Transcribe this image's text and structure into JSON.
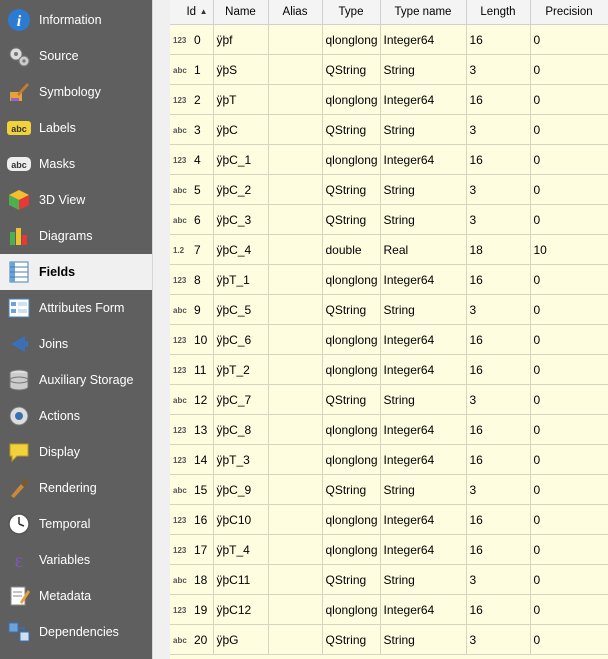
{
  "sidebar": {
    "items": [
      {
        "label": "Information",
        "icon": "information-icon"
      },
      {
        "label": "Source",
        "icon": "source-icon"
      },
      {
        "label": "Symbology",
        "icon": "symbology-icon"
      },
      {
        "label": "Labels",
        "icon": "labels-icon"
      },
      {
        "label": "Masks",
        "icon": "masks-icon"
      },
      {
        "label": "3D View",
        "icon": "3d-view-icon"
      },
      {
        "label": "Diagrams",
        "icon": "diagrams-icon"
      },
      {
        "label": "Fields",
        "icon": "fields-icon",
        "active": true
      },
      {
        "label": "Attributes Form",
        "icon": "attributes-form-icon"
      },
      {
        "label": "Joins",
        "icon": "joins-icon"
      },
      {
        "label": "Auxiliary Storage",
        "icon": "auxiliary-storage-icon"
      },
      {
        "label": "Actions",
        "icon": "actions-icon"
      },
      {
        "label": "Display",
        "icon": "display-icon"
      },
      {
        "label": "Rendering",
        "icon": "rendering-icon"
      },
      {
        "label": "Temporal",
        "icon": "temporal-icon"
      },
      {
        "label": "Variables",
        "icon": "variables-icon"
      },
      {
        "label": "Metadata",
        "icon": "metadata-icon"
      },
      {
        "label": "Dependencies",
        "icon": "dependencies-icon"
      }
    ]
  },
  "table": {
    "headers": [
      "Id",
      "Name",
      "Alias",
      "Type",
      "Type name",
      "Length",
      "Precision"
    ],
    "rows": [
      {
        "tag": "123",
        "id": "0",
        "name": "ÿþf",
        "alias": "",
        "type": "qlonglong",
        "type_name": "Integer64",
        "length": "16",
        "precision": "0"
      },
      {
        "tag": "abc",
        "id": "1",
        "name": "ÿþS",
        "alias": "",
        "type": "QString",
        "type_name": "String",
        "length": "3",
        "precision": "0"
      },
      {
        "tag": "123",
        "id": "2",
        "name": "ÿþT",
        "alias": "",
        "type": "qlonglong",
        "type_name": "Integer64",
        "length": "16",
        "precision": "0"
      },
      {
        "tag": "abc",
        "id": "3",
        "name": "ÿþC",
        "alias": "",
        "type": "QString",
        "type_name": "String",
        "length": "3",
        "precision": "0"
      },
      {
        "tag": "123",
        "id": "4",
        "name": "ÿþC_1",
        "alias": "",
        "type": "qlonglong",
        "type_name": "Integer64",
        "length": "16",
        "precision": "0"
      },
      {
        "tag": "abc",
        "id": "5",
        "name": "ÿþC_2",
        "alias": "",
        "type": "QString",
        "type_name": "String",
        "length": "3",
        "precision": "0"
      },
      {
        "tag": "abc",
        "id": "6",
        "name": "ÿþC_3",
        "alias": "",
        "type": "QString",
        "type_name": "String",
        "length": "3",
        "precision": "0"
      },
      {
        "tag": "1.2",
        "id": "7",
        "name": "ÿþC_4",
        "alias": "",
        "type": "double",
        "type_name": "Real",
        "length": "18",
        "precision": "10"
      },
      {
        "tag": "123",
        "id": "8",
        "name": "ÿþT_1",
        "alias": "",
        "type": "qlonglong",
        "type_name": "Integer64",
        "length": "16",
        "precision": "0"
      },
      {
        "tag": "abc",
        "id": "9",
        "name": "ÿþC_5",
        "alias": "",
        "type": "QString",
        "type_name": "String",
        "length": "3",
        "precision": "0"
      },
      {
        "tag": "123",
        "id": "10",
        "name": "ÿþC_6",
        "alias": "",
        "type": "qlonglong",
        "type_name": "Integer64",
        "length": "16",
        "precision": "0"
      },
      {
        "tag": "123",
        "id": "11",
        "name": "ÿþT_2",
        "alias": "",
        "type": "qlonglong",
        "type_name": "Integer64",
        "length": "16",
        "precision": "0"
      },
      {
        "tag": "abc",
        "id": "12",
        "name": "ÿþC_7",
        "alias": "",
        "type": "QString",
        "type_name": "String",
        "length": "3",
        "precision": "0"
      },
      {
        "tag": "123",
        "id": "13",
        "name": "ÿþC_8",
        "alias": "",
        "type": "qlonglong",
        "type_name": "Integer64",
        "length": "16",
        "precision": "0"
      },
      {
        "tag": "123",
        "id": "14",
        "name": "ÿþT_3",
        "alias": "",
        "type": "qlonglong",
        "type_name": "Integer64",
        "length": "16",
        "precision": "0"
      },
      {
        "tag": "abc",
        "id": "15",
        "name": "ÿþC_9",
        "alias": "",
        "type": "QString",
        "type_name": "String",
        "length": "3",
        "precision": "0"
      },
      {
        "tag": "123",
        "id": "16",
        "name": "ÿþC10",
        "alias": "",
        "type": "qlonglong",
        "type_name": "Integer64",
        "length": "16",
        "precision": "0"
      },
      {
        "tag": "123",
        "id": "17",
        "name": "ÿþT_4",
        "alias": "",
        "type": "qlonglong",
        "type_name": "Integer64",
        "length": "16",
        "precision": "0"
      },
      {
        "tag": "abc",
        "id": "18",
        "name": "ÿþC11",
        "alias": "",
        "type": "QString",
        "type_name": "String",
        "length": "3",
        "precision": "0"
      },
      {
        "tag": "123",
        "id": "19",
        "name": "ÿþC12",
        "alias": "",
        "type": "qlonglong",
        "type_name": "Integer64",
        "length": "16",
        "precision": "0"
      },
      {
        "tag": "abc",
        "id": "20",
        "name": "ÿþG",
        "alias": "",
        "type": "QString",
        "type_name": "String",
        "length": "3",
        "precision": "0"
      }
    ]
  },
  "colors": {
    "sidebar_bg": "#5f5f5f",
    "table_bg": "#fffde0",
    "active_item_bg": "#f0f0f0"
  }
}
